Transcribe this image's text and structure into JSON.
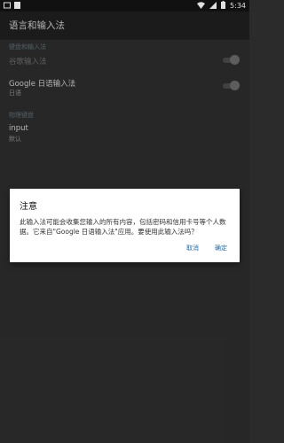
{
  "status_bar": {
    "time": "5:34"
  },
  "toolbar": {
    "title": "语言和输入法"
  },
  "keyboard_section": {
    "header": "键盘和输入法",
    "items": [
      {
        "title": "谷歌输入法",
        "subtitle": "",
        "enabled": false
      },
      {
        "title": "Google 日语输入法",
        "subtitle": "日语",
        "enabled": true
      }
    ]
  },
  "physical_section": {
    "header": "物理键盘",
    "items": [
      {
        "title": "input",
        "subtitle": "默认"
      }
    ]
  },
  "dialog": {
    "title": "注意",
    "body": "此输入法可能会收集您输入的所有内容，包括密码和信用卡号等个人数据。它来自\"Google 日语输入法\"应用。要使用此输入法吗？",
    "cancel_label": "取消",
    "ok_label": "确定"
  }
}
